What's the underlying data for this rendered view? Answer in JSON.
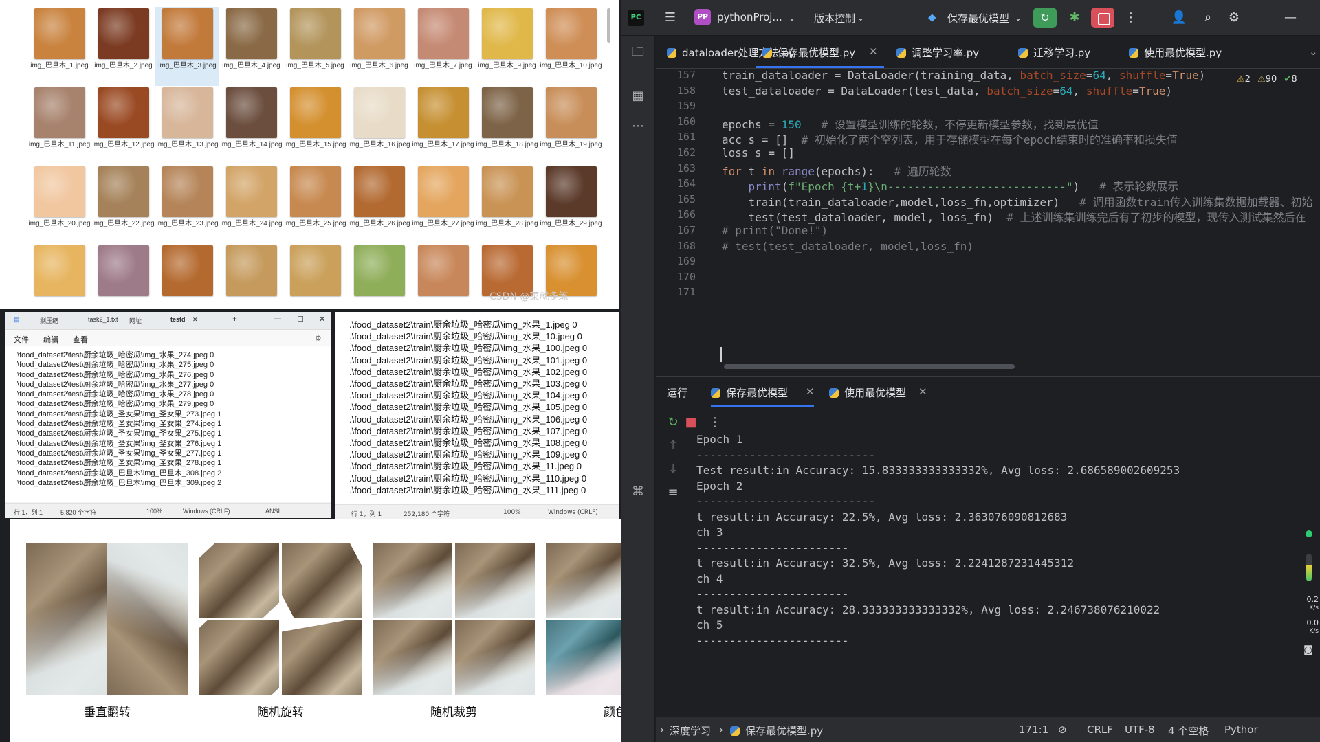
{
  "explorer": {
    "thumbnails": [
      {
        "label": "img_巴旦木_1.jpeg",
        "color": "#c9833f"
      },
      {
        "label": "img_巴旦木_2.jpeg",
        "color": "#7b3b22"
      },
      {
        "label": "img_巴旦木_3.jpeg",
        "color": "#c27a3b"
      },
      {
        "label": "img_巴旦木_4.jpeg",
        "color": "#8a6a46"
      },
      {
        "label": "img_巴旦木_5.jpeg",
        "color": "#b3955c"
      },
      {
        "label": "img_巴旦木_6.jpeg",
        "color": "#d09a63"
      },
      {
        "label": "img_巴旦木_7.jpeg",
        "color": "#c58a73"
      },
      {
        "label": "img_巴旦木_9.jpeg",
        "color": "#e0b84a"
      },
      {
        "label": "img_巴旦木_10.jpeg",
        "color": "#cf8e56"
      },
      {
        "label": "img_巴旦木_11.jpeg",
        "color": "#a7826c"
      },
      {
        "label": "img_巴旦木_12.jpeg",
        "color": "#9a4a23"
      },
      {
        "label": "img_巴旦木_13.jpeg",
        "color": "#d7b69a"
      },
      {
        "label": "img_巴旦木_14.jpeg",
        "color": "#6b4e3e"
      },
      {
        "label": "img_巴旦木_15.jpeg",
        "color": "#d4902f"
      },
      {
        "label": "img_巴旦木_16.jpeg",
        "color": "#e8dcc8"
      },
      {
        "label": "img_巴旦木_17.jpeg",
        "color": "#c69032"
      },
      {
        "label": "img_巴旦木_18.jpeg",
        "color": "#7d6347"
      },
      {
        "label": "img_巴旦木_19.jpeg",
        "color": "#c88e59"
      },
      {
        "label": "img_巴旦木_20.jpeg",
        "color": "#f1c7a0"
      },
      {
        "label": "img_巴旦木_22.jpeg",
        "color": "#a58259"
      },
      {
        "label": "img_巴旦木_23.jpeg",
        "color": "#b58559"
      },
      {
        "label": "img_巴旦木_24.jpeg",
        "color": "#d2a467"
      },
      {
        "label": "img_巴旦木_25.jpeg",
        "color": "#c7894f"
      },
      {
        "label": "img_巴旦木_26.jpeg",
        "color": "#b26a31"
      },
      {
        "label": "img_巴旦木_27.jpeg",
        "color": "#e4a65f"
      },
      {
        "label": "img_巴旦木_28.jpeg",
        "color": "#c99355"
      },
      {
        "label": "img_巴旦木_29.jpeg",
        "color": "#5b3a2a"
      },
      {
        "label": "",
        "color": "#e7b560"
      },
      {
        "label": "",
        "color": "#9e7b88"
      },
      {
        "label": "",
        "color": "#b46a2f"
      },
      {
        "label": "",
        "color": "#c59a5c"
      },
      {
        "label": "",
        "color": "#caa05a"
      },
      {
        "label": "",
        "color": "#8fae5a"
      },
      {
        "label": "",
        "color": "#c8875a"
      },
      {
        "label": "",
        "color": "#b96a33"
      },
      {
        "label": "",
        "color": "#d89030"
      }
    ],
    "selected_index": 2,
    "watermark": "CSDN @菜就多练"
  },
  "notepad1": {
    "tabs": [
      "剩压缩",
      "task2_1.txt",
      "网址",
      "testd"
    ],
    "menu": [
      "文件",
      "编辑",
      "查看"
    ],
    "lines": [
      ".\\food_dataset2\\test\\厨余垃圾_哈密瓜\\img_水果_274.jpeg 0",
      ".\\food_dataset2\\test\\厨余垃圾_哈密瓜\\img_水果_275.jpeg 0",
      ".\\food_dataset2\\test\\厨余垃圾_哈密瓜\\img_水果_276.jpeg 0",
      ".\\food_dataset2\\test\\厨余垃圾_哈密瓜\\img_水果_277.jpeg 0",
      ".\\food_dataset2\\test\\厨余垃圾_哈密瓜\\img_水果_278.jpeg 0",
      ".\\food_dataset2\\test\\厨余垃圾_哈密瓜\\img_水果_279.jpeg 0",
      ".\\food_dataset2\\test\\厨余垃圾_圣女果\\img_圣女果_273.jpeg 1",
      ".\\food_dataset2\\test\\厨余垃圾_圣女果\\img_圣女果_274.jpeg 1",
      ".\\food_dataset2\\test\\厨余垃圾_圣女果\\img_圣女果_275.jpeg 1",
      ".\\food_dataset2\\test\\厨余垃圾_圣女果\\img_圣女果_276.jpeg 1",
      ".\\food_dataset2\\test\\厨余垃圾_圣女果\\img_圣女果_277.jpeg 1",
      ".\\food_dataset2\\test\\厨余垃圾_圣女果\\img_圣女果_278.jpeg 1",
      ".\\food_dataset2\\test\\厨余垃圾_巴旦木\\img_巴旦木_308.jpeg 2",
      ".\\food_dataset2\\test\\厨余垃圾_巴旦木\\img_巴旦木_309.jpeg 2"
    ],
    "status": {
      "pos": "行 1，列 1",
      "chars": "5,820 个字符",
      "zoom": "100%",
      "eol": "Windows (CRLF)",
      "enc": "ANSI"
    }
  },
  "notepad2": {
    "lines": [
      ".\\food_dataset2\\train\\厨余垃圾_哈密瓜\\img_水果_1.jpeg 0",
      ".\\food_dataset2\\train\\厨余垃圾_哈密瓜\\img_水果_10.jpeg 0",
      ".\\food_dataset2\\train\\厨余垃圾_哈密瓜\\img_水果_100.jpeg 0",
      ".\\food_dataset2\\train\\厨余垃圾_哈密瓜\\img_水果_101.jpeg 0",
      ".\\food_dataset2\\train\\厨余垃圾_哈密瓜\\img_水果_102.jpeg 0",
      ".\\food_dataset2\\train\\厨余垃圾_哈密瓜\\img_水果_103.jpeg 0",
      ".\\food_dataset2\\train\\厨余垃圾_哈密瓜\\img_水果_104.jpeg 0",
      ".\\food_dataset2\\train\\厨余垃圾_哈密瓜\\img_水果_105.jpeg 0",
      ".\\food_dataset2\\train\\厨余垃圾_哈密瓜\\img_水果_106.jpeg 0",
      ".\\food_dataset2\\train\\厨余垃圾_哈密瓜\\img_水果_107.jpeg 0",
      ".\\food_dataset2\\train\\厨余垃圾_哈密瓜\\img_水果_108.jpeg 0",
      ".\\food_dataset2\\train\\厨余垃圾_哈密瓜\\img_水果_109.jpeg 0",
      ".\\food_dataset2\\train\\厨余垃圾_哈密瓜\\img_水果_11.jpeg 0",
      ".\\food_dataset2\\train\\厨余垃圾_哈密瓜\\img_水果_110.jpeg 0",
      ".\\food_dataset2\\train\\厨余垃圾_哈密瓜\\img_水果_111.jpeg 0"
    ],
    "status": {
      "pos": "行 1，列 1",
      "chars": "252,180 个字符",
      "zoom": "100%",
      "eol": "Windows (CRLF)"
    }
  },
  "augmentation": {
    "labels": [
      "垂直翻转",
      "随机旋转",
      "随机裁剪",
      "颜色变换"
    ]
  },
  "ide": {
    "project": "pythonProj...",
    "project_badge": "PP",
    "vcs": "版本控制",
    "run_config": "保存最优模型",
    "editor_tabs": [
      "dataloader处理方法.py",
      "保存最优模型.py",
      "调整学习率.py",
      "迁移学习.py",
      "使用最优模型.py"
    ],
    "active_tab": 1,
    "inspections": {
      "warnings": "2",
      "weak": "90",
      "ok": "8"
    },
    "line_numbers": [
      "157",
      "158",
      "159",
      "160",
      "161",
      "162",
      "163",
      "164",
      "165",
      "166",
      "167",
      "168",
      "169",
      "170",
      "171"
    ],
    "code": [
      {
        "t": "train_dataloader = DataLoader(training_data, batch_size=64, shuffle=True)"
      },
      {
        "t": "test_dataloader = DataLoader(test_data, batch_size=64, shuffle=True)"
      },
      {
        "t": ""
      },
      {
        "t": "epochs = 150   # 设置模型训练的轮数，不停更新模型参数，找到最优值"
      },
      {
        "t": "acc_s = []  # 初始化了两个空列表，用于存储模型在每个epoch结束时的准确率和损失值"
      },
      {
        "t": "loss_s = []"
      },
      {
        "t": "for t in range(epochs):   # 遍历轮数"
      },
      {
        "t": "    print(f\"Epoch {t+1}\\n---------------------------\")   # 表示轮数展示"
      },
      {
        "t": "    train(train_dataloader,model,loss_fn,optimizer)   # 调用函数train传入训练集数据加载器、初始"
      },
      {
        "t": "    test(test_dataloader, model, loss_fn)  # 上述训练集训练完后有了初步的模型，现传入测试集然后在"
      },
      {
        "t": "# print(\"Done!\")"
      },
      {
        "t": "# test(test_dataloader, model,loss_fn)"
      },
      {
        "t": ""
      },
      {
        "t": ""
      },
      {
        "t": ""
      }
    ],
    "run_label": "运行",
    "run_tabs": [
      "保存最优模型",
      "使用最优模型"
    ],
    "console": [
      "Epoch 1",
      "---------------------------",
      "Test result:in Accuracy: 15.833333333333332%, Avg loss: 2.686589002609253",
      "Epoch 2",
      "---------------------------",
      "t result:in Accuracy: 22.5%, Avg loss: 2.363076090812683",
      "ch 3",
      "-----------------------",
      "t result:in Accuracy: 32.5%, Avg loss: 2.2241287231445312",
      "ch 4",
      "-----------------------",
      "t result:in Accuracy: 28.333333333333332%, Avg loss: 2.246738076210022",
      "ch 5",
      "-----------------------"
    ],
    "net_up": "0.2",
    "net_down": "0.0",
    "net_unit": "K/s",
    "breadcrumb": [
      "深度学习",
      "保存最优模型.py"
    ],
    "status": {
      "pos": "171:1",
      "eol": "CRLF",
      "enc": "UTF-8",
      "indent": "4 个空格",
      "interp": "Pythor"
    }
  }
}
